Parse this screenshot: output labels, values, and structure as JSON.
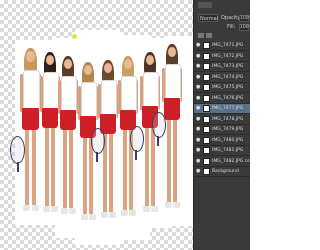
{
  "app": {
    "name": "Adobe Photoshop"
  },
  "canvas": {
    "subject": "tennis team photo composite",
    "colors": {
      "skirt": "#cf1f26",
      "top": "#ffffff",
      "racket": "#3a3f63",
      "checker": "#d9d9d9"
    }
  },
  "layers_panel": {
    "blend_mode": "Normal",
    "opacity_label": "Opacity:",
    "opacity_value": "100%",
    "fill_label": "Fill:",
    "fill_value": "100%",
    "layers": [
      {
        "name": "IMG_7471.JPG",
        "visible": true,
        "selected": false
      },
      {
        "name": "IMG_7472.JPG",
        "visible": true,
        "selected": false
      },
      {
        "name": "IMG_7473.JPG",
        "visible": true,
        "selected": false
      },
      {
        "name": "IMG_7474.JPG",
        "visible": true,
        "selected": false
      },
      {
        "name": "IMG_7475.JPG",
        "visible": true,
        "selected": false
      },
      {
        "name": "IMG_7476.JPG",
        "visible": true,
        "selected": false
      },
      {
        "name": "IMG_7477.JPG",
        "visible": true,
        "selected": true
      },
      {
        "name": "IMG_7478.JPG",
        "visible": true,
        "selected": false
      },
      {
        "name": "IMG_7479.JPG",
        "visible": true,
        "selected": false
      },
      {
        "name": "IMG_7480.JPG",
        "visible": true,
        "selected": false
      },
      {
        "name": "IMG_7481.JPG",
        "visible": true,
        "selected": false
      },
      {
        "name": "IMG_7482.JPG copy",
        "visible": true,
        "selected": false
      },
      {
        "name": "Background",
        "visible": true,
        "selected": false
      }
    ],
    "icons": {
      "eye": "eye-icon",
      "lock": "lock-icon",
      "link": "link-icon"
    }
  }
}
